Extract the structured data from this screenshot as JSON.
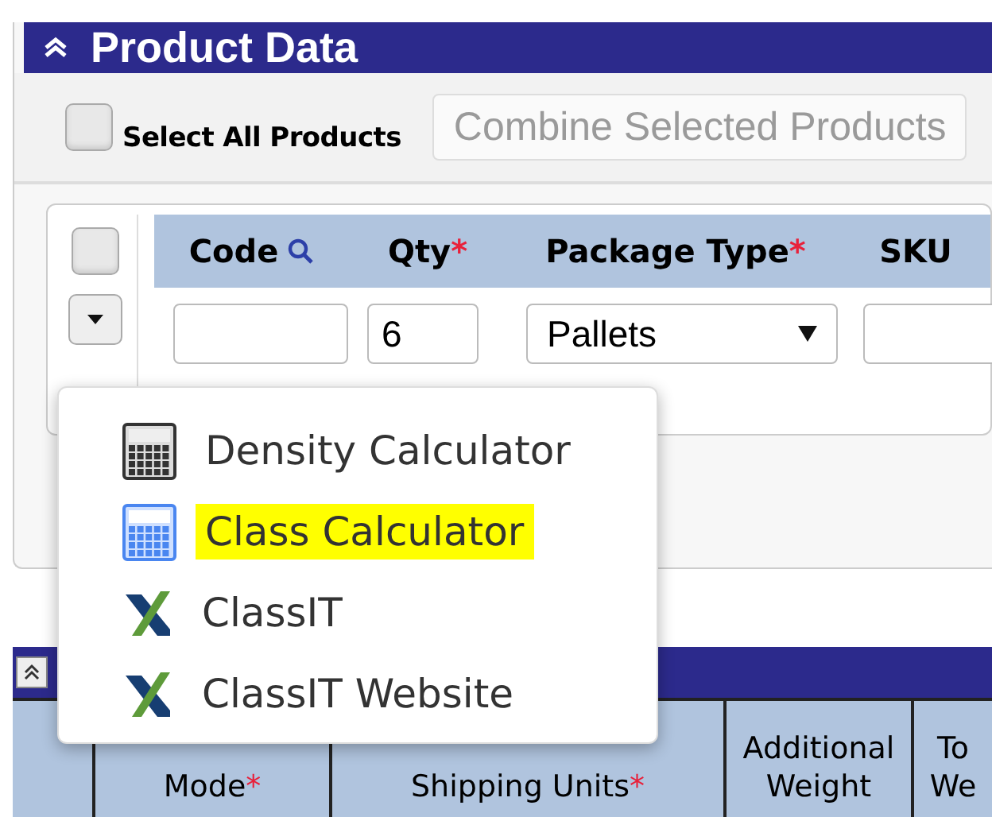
{
  "panel": {
    "title": "Product Data",
    "select_all": {
      "label": "Select All Products",
      "checked": false
    },
    "combine_button": {
      "label": "Combine Selected Products",
      "disabled": true
    }
  },
  "product_table": {
    "row_checked": false,
    "columns": [
      {
        "label": "Code",
        "search": true
      },
      {
        "label": "Qty",
        "search": false,
        "mark": "*"
      },
      {
        "label": "Package Type",
        "search": false,
        "mark": "*"
      },
      {
        "label": "SKU",
        "search": false
      }
    ],
    "row": [
      {
        "kind": "text"
      },
      {
        "kind": "text",
        "value": "6"
      },
      {
        "kind": "select",
        "value": "Pallets"
      },
      {
        "kind": "text"
      }
    ]
  },
  "menu": {
    "items": [
      {
        "label": "Density Calculator",
        "kind": "calculator",
        "highlighted": false
      },
      {
        "label": "Class Calculator",
        "kind": "bluecalculator",
        "highlighted": true
      },
      {
        "label": "ClassIT",
        "kind": "logo",
        "highlighted": false
      },
      {
        "label": "ClassIT Website",
        "kind": "logo",
        "highlighted": false
      }
    ]
  },
  "shipment_table": {
    "columns": [
      {},
      {
        "label": "Mode",
        "mark": "*"
      },
      {
        "label": "Shipping Units",
        "mark": "*"
      },
      {
        "label": "Additional Weight"
      },
      {
        "label": "To We"
      }
    ]
  }
}
